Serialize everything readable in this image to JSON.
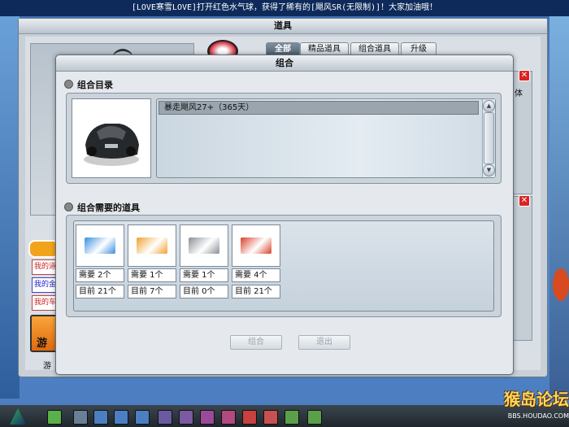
{
  "marquee": "[LOVE寒雪LOVE]打开红色水气球，获得了稀有的[飓风SR(无限制)]！大家加油哦！",
  "outer_window": {
    "title": "道具",
    "tabs": [
      {
        "label": "全部",
        "active": true
      },
      {
        "label": "精品道具",
        "active": false
      },
      {
        "label": "组合道具",
        "active": false
      },
      {
        "label": "升级",
        "active": false
      }
    ],
    "side_buttons": [
      "我的道",
      "我的金",
      "我的车"
    ],
    "side_item_label": "游",
    "side_item_caption": "游",
    "right_panel_text": "体",
    "close_glyph": "✕"
  },
  "dialog": {
    "title": "组合",
    "catalog_section_title": "组合目录",
    "selected_item": "暴走飓风27+（365天）",
    "required_section_title": "组合需要的道具",
    "required_items": [
      {
        "name": "blue-coupon",
        "color": "#3a8fe0",
        "need": "需要 2个",
        "have": "目前 21个"
      },
      {
        "name": "orange-coupon",
        "color": "#f0a030",
        "need": "需要 1个",
        "have": "目前 7个"
      },
      {
        "name": "gray-coupon",
        "color": "#8a8f96",
        "need": "需要 1个",
        "have": "目前 0个"
      },
      {
        "name": "red-coupon",
        "color": "#d8402a",
        "need": "需要 4个",
        "have": "目前 21个"
      }
    ],
    "combine_button": "组合",
    "cancel_button": "退出"
  },
  "watermark": {
    "title": "猴岛论坛",
    "url": "BBS.HOUDAO.COM"
  },
  "colors": {
    "dialog_bg": "#e5e9ed",
    "title_grad": "#bcc6cf",
    "close_red": "#dd2222"
  }
}
